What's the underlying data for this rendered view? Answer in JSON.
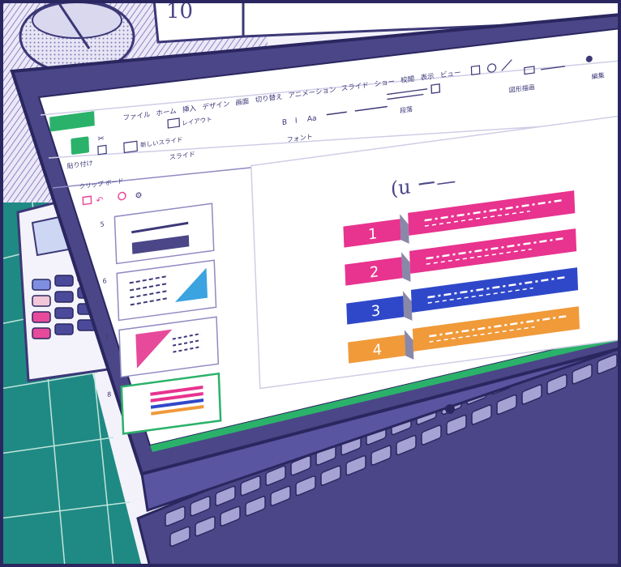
{
  "background_objects": {
    "sticky_note_text": "10",
    "calculator": "calculator",
    "cutting_mat": "cutting-mat",
    "glass": "glass"
  },
  "app": {
    "menu_tabs": [
      "ファイル",
      "ホーム",
      "挿入",
      "デザイン",
      "画面",
      "切り替え",
      "アニメーション",
      "スライド",
      "ショー",
      "校閲",
      "表示",
      "ビュー"
    ],
    "ribbon": {
      "paste_label": "貼り付け",
      "layout_label": "レイアウト",
      "new_slide_label": "新しいスライド",
      "slides_group": "スライド",
      "font_group": "フォント",
      "paragraph_group": "段落",
      "drawing_group": "図形描画",
      "edit_group": "編集"
    },
    "panel_title": "クリップ ボード",
    "thumbnail_numbers": [
      "5",
      "6",
      "7",
      "8"
    ],
    "slide": {
      "title": "(u ー—",
      "items": [
        {
          "number": "1",
          "color": "#e8338f"
        },
        {
          "number": "2",
          "color": "#e8338f"
        },
        {
          "number": "3",
          "color": "#2f48c9"
        },
        {
          "number": "4",
          "color": "#f09a3a"
        }
      ]
    },
    "accent_color": "#2bb26a",
    "laptop_color": "#4b4687"
  }
}
